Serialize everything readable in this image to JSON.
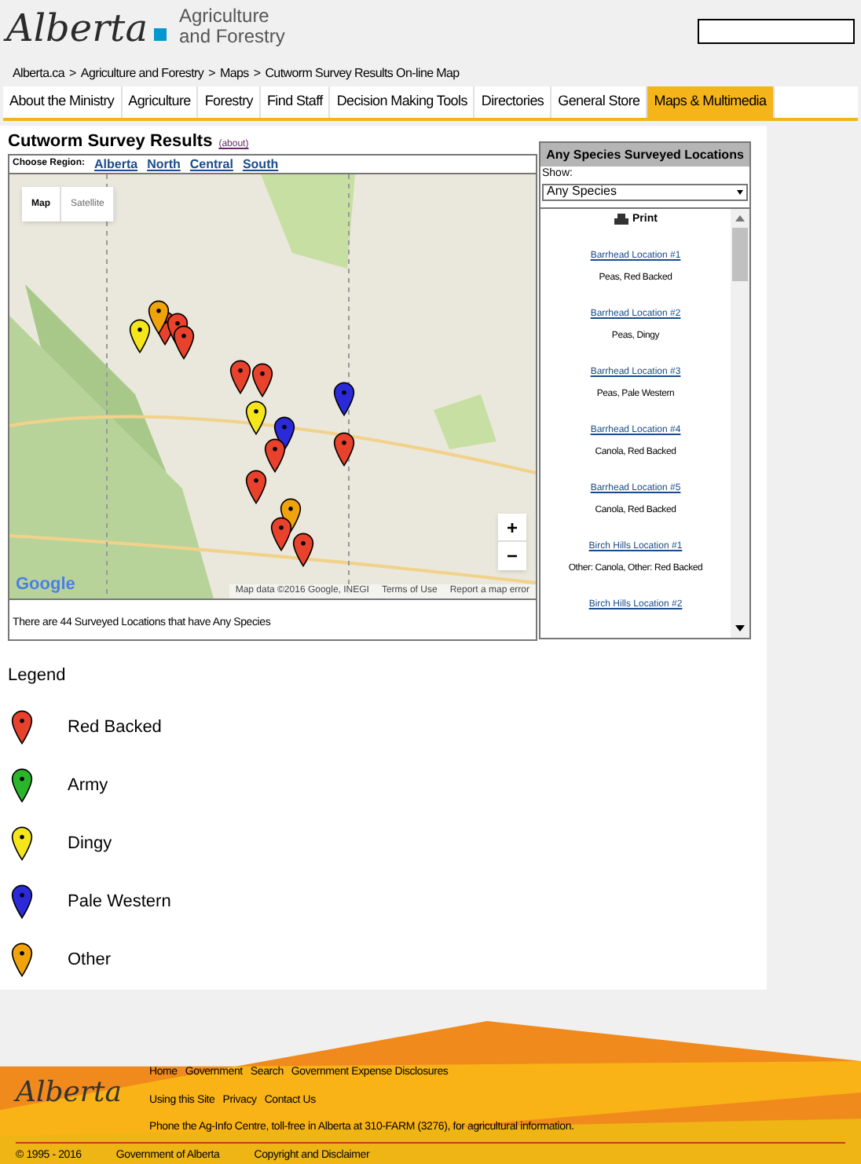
{
  "header": {
    "logo": "Alberta",
    "ministry_line_1": "Agriculture",
    "ministry_line_2": "and Forestry"
  },
  "breadcrumbs": [
    "Alberta.ca",
    "Agriculture and Forestry",
    "Maps",
    "Cutworm Survey Results On-line Map"
  ],
  "breadcrumb_separator": ">",
  "nav": [
    {
      "label": "About the Ministry",
      "selected": false
    },
    {
      "label": "Agriculture",
      "selected": false
    },
    {
      "label": "Forestry",
      "selected": false
    },
    {
      "label": "Find Staff",
      "selected": false
    },
    {
      "label": "Decision Making Tools",
      "selected": false
    },
    {
      "label": "Directories",
      "selected": false
    },
    {
      "label": "General Store",
      "selected": false
    },
    {
      "label": "Maps & Multimedia",
      "selected": true
    }
  ],
  "page_title": "Cutworm Survey Results",
  "about_link": "(about)",
  "region_label": "Choose Region:",
  "regions": [
    "Alberta",
    "North",
    "Central",
    "South"
  ],
  "map": {
    "types": [
      {
        "label": "Map",
        "selected": true
      },
      {
        "label": "Satellite",
        "selected": false
      }
    ],
    "zoom_in": "+",
    "zoom_out": "−",
    "google": "Google",
    "attribution": "Map data ©2016 Google, INEGI",
    "terms": "Terms of Use",
    "report": "Report a map error",
    "markers": [
      {
        "color": "#e8412c"
      },
      {
        "color": "#e8412c"
      },
      {
        "color": "#f0a30a"
      },
      {
        "color": "#f5e61c"
      },
      {
        "color": "#e8412c"
      },
      {
        "color": "#e8412c"
      },
      {
        "color": "#2a2ad8"
      },
      {
        "color": "#e8412c"
      },
      {
        "color": "#f5e61c"
      },
      {
        "color": "#2a2ad8"
      },
      {
        "color": "#e8412c"
      },
      {
        "color": "#e8412c"
      },
      {
        "color": "#e8412c"
      },
      {
        "color": "#f0a30a"
      },
      {
        "color": "#e8412c"
      },
      {
        "color": "#e8412c"
      }
    ]
  },
  "summary": "There are 44 Surveyed Locations that have Any Species",
  "side_panel": {
    "title": "Any Species Surveyed Locations",
    "show_label": "Show:",
    "show_value": "Any Species",
    "print": "Print",
    "locations": [
      {
        "name": "Barrhead Location #1",
        "detail": "Peas, Red Backed"
      },
      {
        "name": "Barrhead Location #2",
        "detail": "Peas, Dingy"
      },
      {
        "name": "Barrhead Location #3",
        "detail": "Peas, Pale Western"
      },
      {
        "name": "Barrhead Location #4",
        "detail": "Canola, Red Backed"
      },
      {
        "name": "Barrhead Location #5",
        "detail": "Canola, Red Backed"
      },
      {
        "name": "Birch Hills Location #1",
        "detail": "Other: Canola, Other: Red Backed"
      },
      {
        "name": "Birch Hills Location #2"
      }
    ]
  },
  "legend": {
    "title": "Legend",
    "items": [
      {
        "label": "Red Backed",
        "color": "#e8412c"
      },
      {
        "label": "Army",
        "color": "#2bb52b"
      },
      {
        "label": "Dingy",
        "color": "#f5e61c"
      },
      {
        "label": "Pale Western",
        "color": "#2a2ad8"
      },
      {
        "label": "Other",
        "color": "#f0a30a"
      }
    ]
  },
  "footer": {
    "logo": "Alberta",
    "links_row_1": [
      "Home",
      "Government",
      "Search",
      "Government Expense Disclosures"
    ],
    "links_row_2": [
      "Using this Site",
      "Privacy",
      "Contact Us"
    ],
    "phone": "Phone the Ag-Info Centre, toll-free in Alberta at 310-FARM (3276), for agricultural information.",
    "copyright": "© 1995 - 2016",
    "government": "Government of Alberta",
    "disclaimer": "Copyright and Disclaimer"
  }
}
